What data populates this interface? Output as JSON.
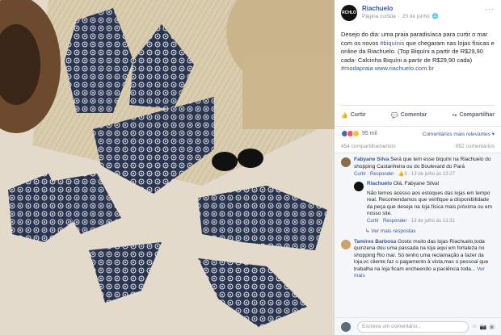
{
  "page": {
    "name": "Riachuelo",
    "logo_text": "RCHLO",
    "subtitle": "Página curtida",
    "date": "20 de junho",
    "privacy_icon": "globe-icon"
  },
  "post": {
    "text_a": "Desejo do dia: uma praia paradisíaca para curtir o mar com os novos ",
    "hashtag1": "#biquínis",
    "text_b": " que chegaram nas lojas físicas e online da Riachuelo. (Top Biquíni a partir de R$29,90 cada- Calcinha Biquíni a partir de R$29,90 cada) ",
    "hashtag2": "#modapraia",
    "link": "www.riachuelo.com.br"
  },
  "actions": {
    "like": "Curtir",
    "comment": "Comentar",
    "share": "Compartilhar"
  },
  "reactions": {
    "count": "95 mil",
    "sort_label": "Comentários mais relevantes ▾",
    "shares": "454 compartilhamentos",
    "comments": "892 comentários"
  },
  "comments": [
    {
      "name": "Fabyane Silva",
      "text": "Será que tem esse biquíni na Riachuelo do shopping Castanheira ou do Boulevard do Pará",
      "like": "Curtir",
      "reply": "Responder",
      "likes": "3",
      "time": "13 de julho às 13:27"
    },
    {
      "name": "Riachuelo",
      "mention": "Olá, Fabyane Silva!",
      "text": "Não temos acesso aos estoques das lojas em tempo real. Recomendamos que verifique a disponibilidade da peça que deseja na loja física mais próxima ou em nosso site.",
      "like": "Curtir",
      "reply": "Responder",
      "time": "13 de julho às 13:31"
    },
    {
      "name": "Tamires Barbosa",
      "text": "Gosto muito das lojas Riachuelo,toda quinzena dou uma passada na loja aqui em fortaleza no shopping Rio mar. Só tenho uma reclamação a fazer da loja,vc cliente faz o pagamento à vista,mas o pessoal que trabalha na loja ficam encheendo a paciência toda...",
      "see_more": "Ver mais"
    }
  ],
  "more_replies": "Ver mais respostas",
  "composer": {
    "placeholder": "Escreva um comentário..."
  },
  "colors": {
    "link": "#365899",
    "like_blue": "#4267b2",
    "love_red": "#f25268",
    "wow_yellow": "#f7c23b"
  }
}
